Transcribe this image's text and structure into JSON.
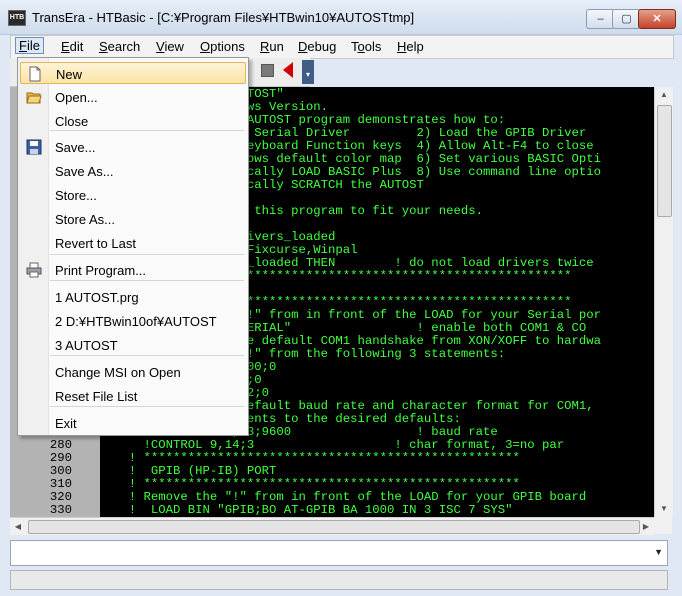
{
  "window": {
    "app_icon": "HTB",
    "title": "TransEra - HTBasic - [C:¥Program Files¥HTBwin10¥AUTOSTtmp]",
    "minimize": "–",
    "maximize": "▢",
    "close": "✕"
  },
  "menu": [
    {
      "label": "File",
      "hotkey": "F",
      "rest": "ile"
    },
    {
      "label": "Edit",
      "hotkey": "E",
      "rest": "dit"
    },
    {
      "label": "Search",
      "hotkey": "S",
      "rest": "earch"
    },
    {
      "label": "View",
      "hotkey": "V",
      "rest": "iew"
    },
    {
      "label": "Options",
      "hotkey": "O",
      "rest": "ptions"
    },
    {
      "label": "Run",
      "hotkey": "R",
      "rest": "un"
    },
    {
      "label": "Debug",
      "hotkey": "D",
      "rest": "ebug"
    },
    {
      "label": "Tools",
      "hotkey": "o",
      "rest": "ls"
    },
    {
      "label": "Help",
      "hotkey": "H",
      "rest": "elp"
    }
  ],
  "file_menu": [
    {
      "label": "New",
      "icon": "new-document-icon",
      "highlighted": true
    },
    {
      "label": "Open...",
      "icon": "open-folder-icon"
    },
    {
      "label": "Close"
    },
    {
      "label": "Save...",
      "icon": "save-disk-icon"
    },
    {
      "label": "Save As..."
    },
    {
      "label": "Store..."
    },
    {
      "label": "Store As..."
    },
    {
      "label": "Revert to Last"
    },
    {
      "label": "Print Program...",
      "icon": "printer-icon"
    },
    {
      "label": "1 AUTOST.prg"
    },
    {
      "label": "2 D:¥HTBwin10of¥AUTOST"
    },
    {
      "label": "3 AUTOST"
    },
    {
      "label": "Change MSI on Open"
    },
    {
      "label": "Reset File List"
    },
    {
      "label": "Exit"
    }
  ],
  "code_lines": [
    {
      "num": "",
      "text": "                AUTOST\""
    },
    {
      "num": "",
      "text": "               ndows Version."
    },
    {
      "num": "",
      "text": "               le AUTOST program demonstrates how to:"
    },
    {
      "num": "",
      "text": "               the Serial Driver         2) Load the GPIB Driver"
    },
    {
      "num": "",
      "text": "               n Keyboard Function keys  4) Allow Alt-F4 to close"
    },
    {
      "num": "",
      "text": "               indows default color map  6) Set various BASIC Opti"
    },
    {
      "num": "",
      "text": "               atically LOAD BASIC Plus  8) Use command line optio"
    },
    {
      "num": "",
      "text": "               atically SCRATCH the AUTOST"
    },
    {
      "num": "",
      "text": ""
    },
    {
      "num": "",
      "text": "               ify this program to fit your needs."
    },
    {
      "num": "",
      "text": ""
    },
    {
      "num": "",
      "text": "               /Drivers_loaded"
    },
    {
      "num": "",
      "text": "               f4,Fixcurse,Winpal"
    },
    {
      "num": "",
      "text": "               ers_loaded THEN        ! do not load drivers twice"
    },
    {
      "num": "",
      "text": "               ***********************************************"
    },
    {
      "num": "",
      "text": "               RTS"
    },
    {
      "num": "",
      "text": "               ***********************************************"
    },
    {
      "num": "",
      "text": "               e \"!\" from in front of the LOAD for your Serial por"
    },
    {
      "num": "",
      "text": "                \"SERIAL\"                 ! enable both COM1 & CO"
    },
    {
      "num": "",
      "text": "                the default COM1 handshake from XON/XOFF to hardwa"
    },
    {
      "num": "",
      "text": "               e \"!\" from the following 3 statements:"
    },
    {
      "num": "",
      "text": "               9,100;0"
    },
    {
      "num": "",
      "text": "               9,5;0"
    },
    {
      "num": "",
      "text": "               9,12;0"
    },
    {
      "num": "",
      "text": "               e default baud rate and character format for COM1,"
    },
    {
      "num": "",
      "text": "               tements to the desired defaults:"
    },
    {
      "num": "",
      "text": "               9,13;9600                 ! baud rate"
    },
    {
      "num": "280",
      "text": "    !CONTROL 9,14;3                   ! char format, 3=no par"
    },
    {
      "num": "290",
      "text": "  ! ***************************************************"
    },
    {
      "num": "300",
      "text": "  !  GPIB (HP-IB) PORT"
    },
    {
      "num": "310",
      "text": "  ! ***************************************************"
    },
    {
      "num": "320",
      "text": "  ! Remove the \"!\" from in front of the LOAD for your GPIB board"
    },
    {
      "num": "330",
      "text": "  !  LOAD BIN \"GPIB;BO AT-GPIB BA 1000 IN 3 ISC 7 SYS\""
    }
  ],
  "command_line": {
    "value": ""
  },
  "colors": {
    "code_text": "#41ff41",
    "editor_bg": "#000000",
    "gutter_bg": "#b3b3b3",
    "highlight": "#fbe4a6"
  }
}
